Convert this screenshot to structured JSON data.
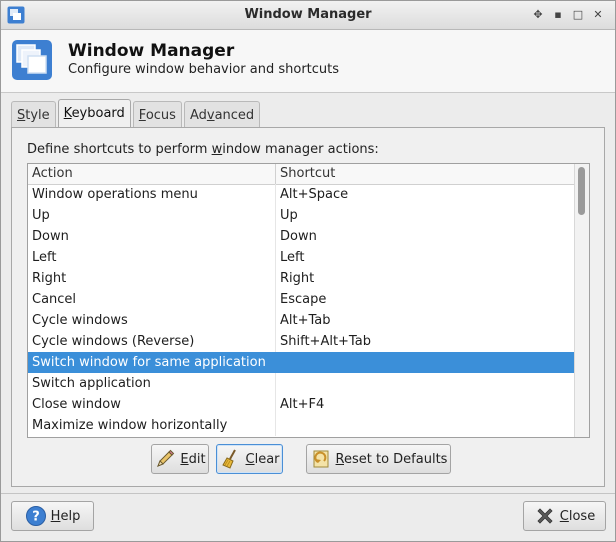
{
  "window": {
    "title": "Window Manager"
  },
  "header": {
    "title": "Window Manager",
    "subtitle": "Configure window behavior and shortcuts"
  },
  "tabs": [
    {
      "pre": "",
      "u": "S",
      "post": "tyle"
    },
    {
      "pre": "",
      "u": "K",
      "post": "eyboard"
    },
    {
      "pre": "",
      "u": "F",
      "post": "ocus"
    },
    {
      "pre": "Ad",
      "u": "v",
      "post": "anced"
    }
  ],
  "keyboard": {
    "description_pre": "Define shortcuts to perform ",
    "description_u": "w",
    "description_post": "indow manager actions:",
    "columns": {
      "action": "Action",
      "shortcut": "Shortcut"
    },
    "rows": [
      {
        "action": "Window operations menu",
        "shortcut": "Alt+Space"
      },
      {
        "action": "Up",
        "shortcut": "Up"
      },
      {
        "action": "Down",
        "shortcut": "Down"
      },
      {
        "action": "Left",
        "shortcut": "Left"
      },
      {
        "action": "Right",
        "shortcut": "Right"
      },
      {
        "action": "Cancel",
        "shortcut": "Escape"
      },
      {
        "action": "Cycle windows",
        "shortcut": "Alt+Tab"
      },
      {
        "action": "Cycle windows (Reverse)",
        "shortcut": "Shift+Alt+Tab"
      },
      {
        "action": "Switch window for same application",
        "shortcut": ""
      },
      {
        "action": "Switch application",
        "shortcut": ""
      },
      {
        "action": "Close window",
        "shortcut": "Alt+F4"
      },
      {
        "action": "Maximize window horizontally",
        "shortcut": ""
      }
    ],
    "selected_row": "Switch window for same application",
    "buttons": {
      "edit": {
        "u": "E",
        "post": "dit"
      },
      "clear": {
        "u": "C",
        "post": "lear"
      },
      "reset": {
        "u": "R",
        "post": "eset to Defaults"
      }
    }
  },
  "footer": {
    "help": {
      "u": "H",
      "post": "elp"
    },
    "close": {
      "u": "C",
      "post": "lose"
    }
  },
  "colors": {
    "selection": "#3b8fd9",
    "accent_icon": "#3d7fd1"
  }
}
